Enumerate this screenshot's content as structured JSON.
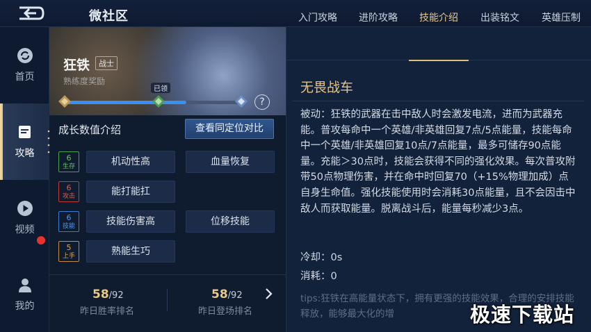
{
  "header": {
    "title": "微社区"
  },
  "sidebar": {
    "items": [
      {
        "label": "首页",
        "icon": "refresh-icon"
      },
      {
        "label": "攻略",
        "icon": "guide-icon",
        "active": true
      },
      {
        "label": "视频",
        "icon": "play-icon"
      },
      {
        "label": "我的",
        "icon": "user-icon",
        "badge": true
      }
    ]
  },
  "hero": {
    "name": "狂铁",
    "role": "战士",
    "proficiency": "熟练度奖励",
    "claimed": "已领",
    "progress": 0.68,
    "help": "?"
  },
  "growth": {
    "title": "成长数值介绍",
    "compare_button": "查看同定位对比",
    "stats": [
      {
        "value": "6",
        "label": "生存",
        "color": "#4aa34a"
      },
      {
        "value": "6",
        "label": "攻击",
        "color": "#d2453c"
      },
      {
        "value": "6",
        "label": "技能",
        "color": "#3d79d6"
      },
      {
        "value": "5",
        "label": "上手",
        "color": "#d39a43"
      }
    ],
    "tags": [
      "机动性高",
      "血量恢复",
      "能打能扛",
      "技能伤害高",
      "位移技能",
      "熟能生巧"
    ]
  },
  "ranks": [
    {
      "num": "58",
      "den": "/92",
      "label": "昨日胜率排名"
    },
    {
      "num": "58",
      "den": "/92",
      "label": "昨日登场排名"
    }
  ],
  "tabs": [
    "入门攻略",
    "进阶攻略",
    "技能介绍",
    "出装铭文",
    "英雄压制"
  ],
  "active_tab": "技能介绍",
  "skill": {
    "name": "无畏战车",
    "description": "被动：狂铁的武器在击中敌人时会激发电流，进而为武器充能。普攻每命中一个英雄/非英雄回复7点/5点能量，技能每命中一个英雄/非英雄回复10点/7点能量，最多可储存90点能量。充能＞30点时，技能会获得不同的强化效果。每次普攻附带50点物理伤害，并在命中时回复70（+15%物理加成）点自身生命值。强化技能使用时会消耗30点能量，且不会因击中敌人而获取能量。脱离战斗后，能量每秒减少3点。",
    "cooldown": "冷却：0s",
    "cost": "消耗：0",
    "tips": "tips:狂铁在高能量状态下，拥有更强的技能效果，合理的安排技能释放，能够最大化的增"
  },
  "watermark": "极速下载站"
}
